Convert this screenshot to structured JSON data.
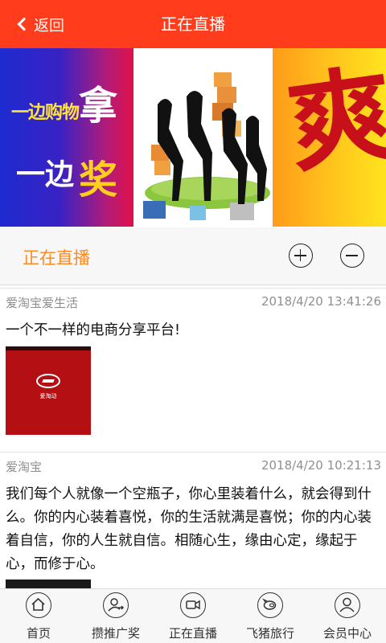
{
  "header": {
    "back_label": "返回",
    "title": "正在直播"
  },
  "banner": {
    "panel1": {
      "line1": "一边购物",
      "line2": "一边",
      "big1": "拿",
      "big2": "奖"
    },
    "panel3": {
      "big": "爽"
    }
  },
  "section": {
    "title": "正在直播"
  },
  "posts": [
    {
      "author": "爱淘宝爱生活",
      "time": "2018/4/20 13:41:26",
      "content": "一个不一样的电商分享平台!",
      "thumb_caption": "爱淘动"
    },
    {
      "author": "爱淘宝",
      "time": "2018/4/20 10:21:13",
      "content": "我们每个人就像一个空瓶子，你心里装着什么，就会得到什么。你的内心装着喜悦，你的生活就满是喜悦；你的内心装着自信，你的人生就自信。相随心生，缘由心定，缘起于心，而修于心。"
    }
  ],
  "nav": {
    "items": [
      {
        "label": "首页",
        "icon": "home-icon"
      },
      {
        "label": "攒推广奖",
        "icon": "user-share-icon"
      },
      {
        "label": "正在直播",
        "icon": "video-camera-icon"
      },
      {
        "label": "飞猪旅行",
        "icon": "pig-icon"
      },
      {
        "label": "会员中心",
        "icon": "user-icon"
      }
    ]
  },
  "colors": {
    "header_bg": "#ff3d1c",
    "section_title": "#ff8a1f",
    "meta_text": "#8f8f8f"
  }
}
